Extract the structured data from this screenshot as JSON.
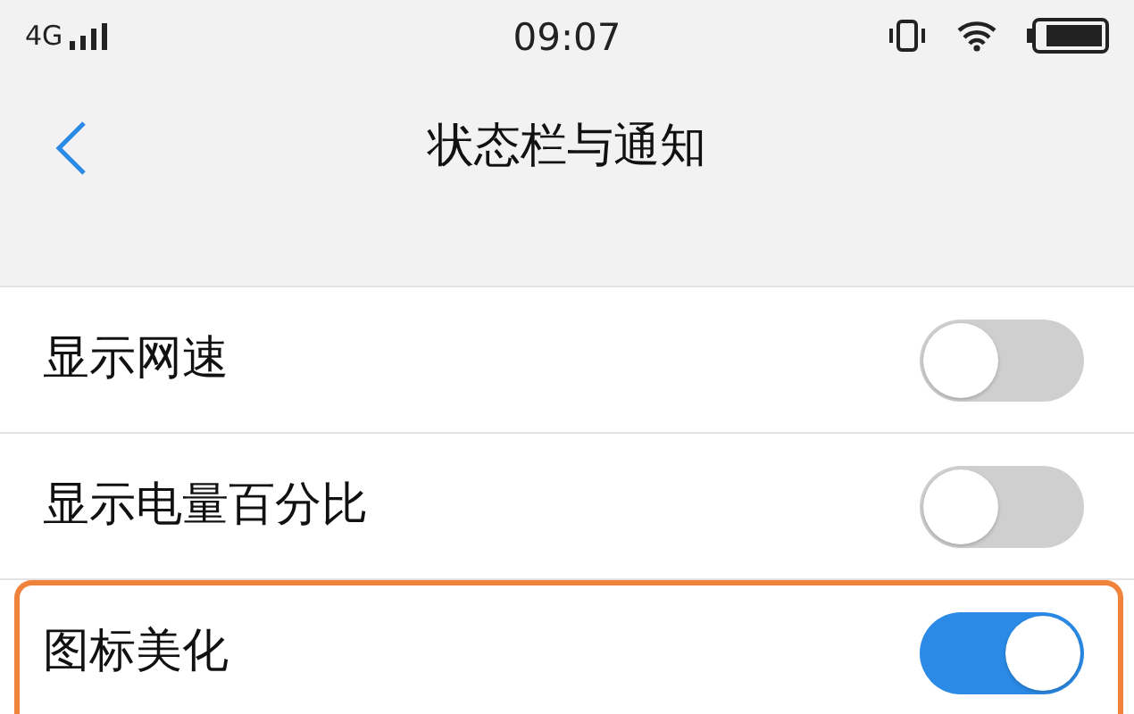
{
  "status_bar": {
    "network": "4G",
    "time": "09:07"
  },
  "nav": {
    "title": "状态栏与通知"
  },
  "settings": [
    {
      "label": "显示网速",
      "on": false,
      "highlighted": false
    },
    {
      "label": "显示电量百分比",
      "on": false,
      "highlighted": false
    },
    {
      "label": "图标美化",
      "on": true,
      "highlighted": true
    }
  ]
}
